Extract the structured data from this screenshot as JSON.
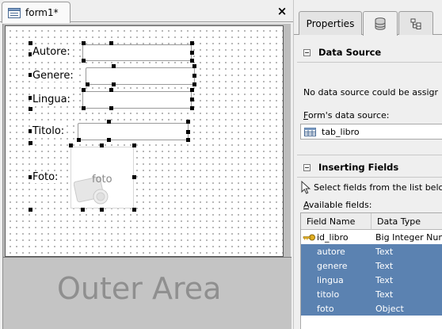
{
  "document_tab": {
    "title": "form1*",
    "close_glyph": "×",
    "icon": "form-table-icon"
  },
  "form": {
    "fields": [
      {
        "label": "Autore:"
      },
      {
        "label": "Genere:"
      },
      {
        "label": "Lingua:"
      },
      {
        "label": "Titolo:"
      },
      {
        "label": "Foto:"
      }
    ],
    "photo_placeholder": "foto",
    "outer_area_label": "Outer Area"
  },
  "property_pane": {
    "tabs": [
      {
        "label": "Properties",
        "icon": ""
      },
      {
        "label": "",
        "icon": "database-icon",
        "active": true
      },
      {
        "label": "",
        "icon": "widget-tree-icon"
      }
    ],
    "data_source": {
      "heading": "Data Source",
      "message": "No data source could be assigr",
      "form_source_label": "Form's data source:",
      "form_source_value": "tab_libro"
    },
    "inserting_fields": {
      "heading": "Inserting Fields",
      "hint": "Select fields from the list belo",
      "available_label": "Available fields:",
      "columns": [
        "Field Name",
        "Data Type"
      ],
      "rows": [
        {
          "name": "id_libro",
          "type": "Big Integer Num",
          "primary_key": true,
          "selected": false
        },
        {
          "name": "autore",
          "type": "Text",
          "selected": true
        },
        {
          "name": "genere",
          "type": "Text",
          "selected": true
        },
        {
          "name": "lingua",
          "type": "Text",
          "selected": true
        },
        {
          "name": "titolo",
          "type": "Text",
          "selected": true
        },
        {
          "name": "foto",
          "type": "Object",
          "selected": true
        }
      ]
    }
  },
  "colors": {
    "selection": "#5b82b1",
    "outer_area_text": "#8f8f8f"
  }
}
